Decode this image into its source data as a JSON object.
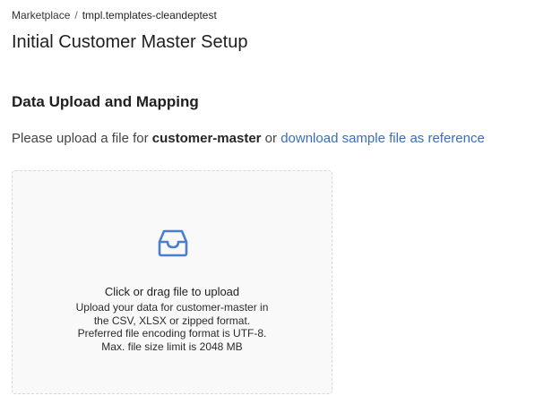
{
  "breadcrumb": {
    "root": "Marketplace",
    "separator": "/",
    "current": "tmpl.templates-cleandeptest"
  },
  "page": {
    "title": "Initial Customer Master Setup"
  },
  "section": {
    "title": "Data Upload and Mapping"
  },
  "instruction": {
    "prefix": "Please upload a file for ",
    "entity": "customer-master",
    "middle": " or ",
    "link": "download sample file as reference"
  },
  "dropzone": {
    "icon": "inbox-icon",
    "title": "Click or drag file to upload",
    "lines": [
      "Upload your data for customer-master in",
      "the CSV, XLSX or zipped format.",
      "Preferred file encoding format is UTF-8.",
      "Max. file size limit is 2048 MB"
    ]
  },
  "colors": {
    "link": "#3a6fb5",
    "icon": "#4a7fd0",
    "dropzone_bg": "#f9f9f9",
    "dropzone_border": "#d9d9d9"
  }
}
